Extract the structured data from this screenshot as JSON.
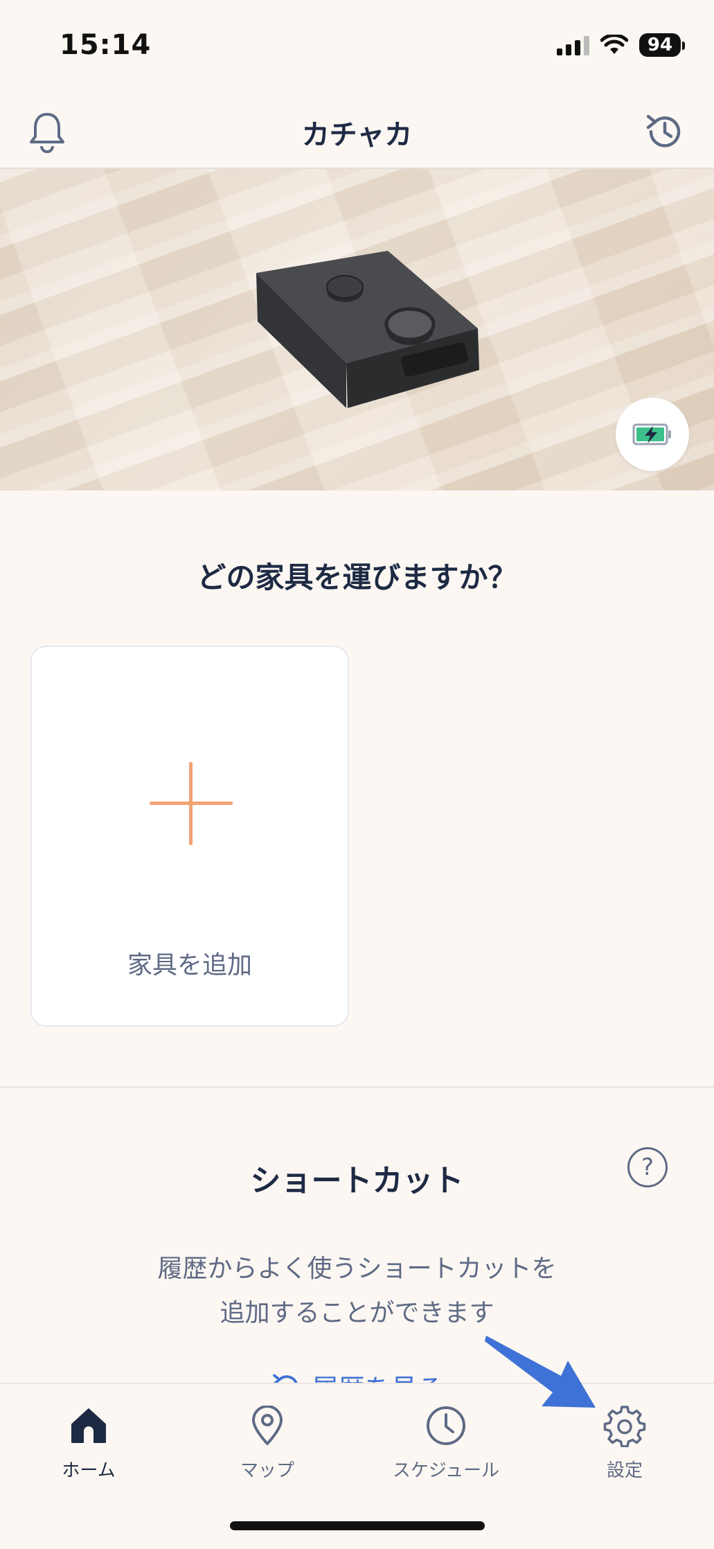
{
  "status_bar": {
    "time": "15:14",
    "battery": "94"
  },
  "header": {
    "title": "カチャカ"
  },
  "hero": {
    "battery_state": "charging"
  },
  "main": {
    "question": "どの家具を運びますか？",
    "add_furniture_label": "家具を追加"
  },
  "shortcut": {
    "title": "ショートカット",
    "help_glyph": "?",
    "description_line1": "履歴からよく使うショートカットを",
    "description_line2": "追加することができます",
    "history_link": "履歴を見る"
  },
  "tabbar": {
    "items": [
      {
        "label": "ホーム",
        "icon": "home-icon",
        "active": true
      },
      {
        "label": "マップ",
        "icon": "map-pin-icon",
        "active": false
      },
      {
        "label": "スケジュール",
        "icon": "clock-icon",
        "active": false
      },
      {
        "label": "設定",
        "icon": "gear-icon",
        "active": false
      }
    ]
  },
  "colors": {
    "background": "#fcf7f2",
    "navy": "#1e2a44",
    "muted": "#5e6a85",
    "accent_orange": "#f2a375",
    "link_blue": "#3f72d6",
    "annotation_arrow": "#3f72d6"
  }
}
